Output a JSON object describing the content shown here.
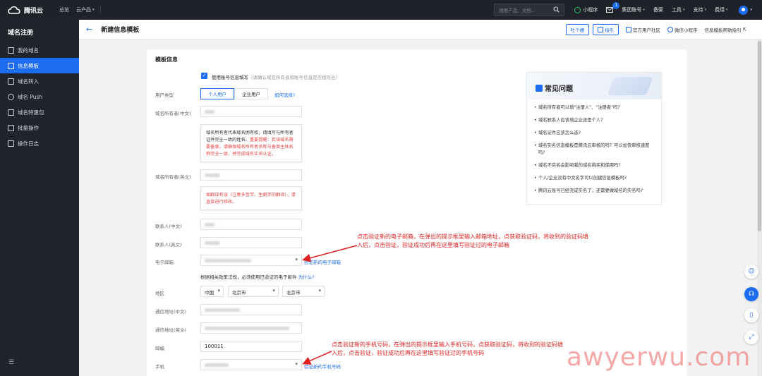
{
  "topbar": {
    "brand": "腾讯云",
    "links": [
      "总览",
      "云产品"
    ],
    "search_placeholder": "搜索产品、文档...",
    "mini_program": "小程序",
    "mail_badge": "1",
    "group_account": "集团账号",
    "filing": "备案",
    "tools": "工具",
    "support": "支持",
    "billing": "费用"
  },
  "sidebar": {
    "title": "域名注册",
    "items": [
      {
        "label": "我的域名",
        "icon": "list-icon"
      },
      {
        "label": "信息模板",
        "icon": "template-icon",
        "active": true
      },
      {
        "label": "域名转入",
        "icon": "transfer-icon"
      },
      {
        "label": "域名 Push",
        "icon": "push-icon"
      },
      {
        "label": "域名特惠包",
        "icon": "package-icon"
      },
      {
        "label": "批量操作",
        "icon": "batch-icon"
      },
      {
        "label": "操作日志",
        "icon": "log-icon"
      }
    ]
  },
  "header": {
    "title": "新建信息模板",
    "feedback": "吐个槽",
    "guide": "指引",
    "community": "官方用户社区",
    "wechat": "微信小程序",
    "help": "信息模板帮助指引"
  },
  "form": {
    "section_title": "模板信息",
    "use_account_info": "使用账号信息填写",
    "use_account_hint": "（请确认域名所有者和账号信息是否相符合）",
    "user_type_label": "用户类型",
    "user_type_personal": "个人用户",
    "user_type_company": "企业用户",
    "how_choose": "如何选择?",
    "owner_cn_label": "域名所有者(中文)",
    "owner_tip_plain": "域名所有者代表域名拥有权，请填写与所有者证件完全一致的姓名。",
    "owner_tip_red": "重要提醒：若该域名需要备案，请确保域名所有者名称与备案主体名称完全一致，并完成域名实名认证。",
    "owner_en_label": "域名所有者(英文)",
    "owner_en_tip": "如翻译有误（注意多音字、生僻字的翻译），请直接进行修改。",
    "contact_cn_label": "联系人(中文)",
    "contact_en_label": "联系人(英文)",
    "email_label": "电子邮箱",
    "verify_email": "验证新的电子邮箱",
    "email_policy": "根据相关政策法规，必须使用已验证的电子邮件",
    "why": "为什么?",
    "region_label": "地区",
    "country": "中国",
    "province": "北京市",
    "city": "北京市",
    "address_cn_label": "通信地址(中文)",
    "address_en_label": "通信地址(英文)",
    "postcode_label": "邮编",
    "postcode_value": "100011",
    "phone_label": "手机",
    "verify_phone": "验证新的手机号码"
  },
  "annotations": {
    "email": "点击验证新的电子邮箱，在弹出的提示框里输入邮箱地址，点获取验证码，将收到的验证码填入后，点击验证，验证成功后再在这里填写验证过的电子邮箱",
    "phone": "点击验证新的手机号码，在弹出的提示框里输入手机号码，点获取验证码，将收到的验证码填入后，点击验证，验证成功后再在这里填写验证过的手机号码"
  },
  "faq": {
    "title": "常见问题",
    "items": [
      "域名所有者可以填\"注册人\"、\"注册者\"吗?",
      "域名联系人应该填企业还是个人?",
      "域名证件应该怎么选?",
      "域名实名信息模板是腾讯云审核的吗？可以加快审核速度吗?",
      "域名不实名会影响我的域名购买和使用吗?",
      "个人/企业没有中文名字可以创建信息模板吗?",
      "腾讯云账号已经完成实名了，还需要做域名的实名吗?"
    ]
  },
  "watermark": "awyerwu.com",
  "colors": {
    "accent": "#1c6cf2",
    "topbar": "#1f2329",
    "sidebar": "#20252c",
    "annotation": "#e02020"
  }
}
